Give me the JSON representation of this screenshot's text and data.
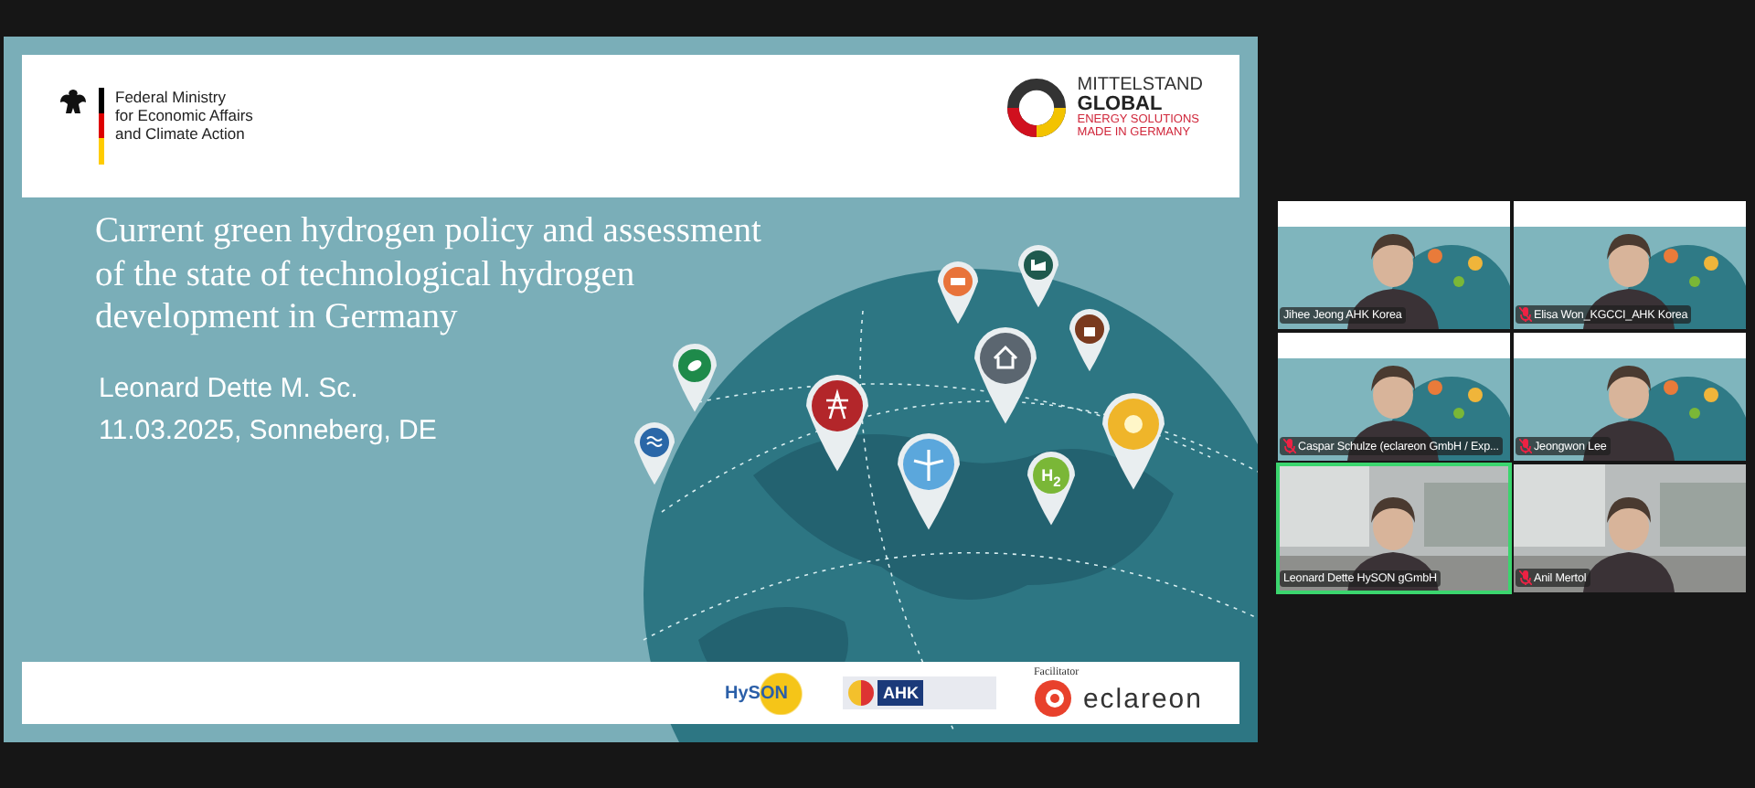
{
  "slide": {
    "header": {
      "ministry_lines": [
        "Federal Ministry",
        "for Economic Affairs",
        "and Climate Action"
      ],
      "brand_name": "MITTELSTAND",
      "brand_bold": "GLOBAL",
      "brand_tagline": [
        "ENERGY SOLUTIONS",
        "MADE IN GERMANY"
      ]
    },
    "title_lines": [
      "Current green hydrogen policy and assessment",
      "of the state of technological hydrogen",
      "development in Germany"
    ],
    "speaker": "Leonard Dette M. Sc.",
    "date_place": "11.03.2025, Sonneberg, DE",
    "pin_label": "H$_{2}$",
    "footer": {
      "hyson": "HySON",
      "ahk": "AHK",
      "facilitator": "Facilitator",
      "eclareon": "eclareon"
    }
  },
  "participants": [
    {
      "name": "Jihee Jeong AHK Korea",
      "muted": false,
      "speaking": false
    },
    {
      "name": "Elisa Won_KGCCI_AHK Korea",
      "muted": true,
      "speaking": false
    },
    {
      "name": "Caspar Schulze (eclareon GmbH / Exp...",
      "muted": true,
      "speaking": false
    },
    {
      "name": "Jeongwon Lee",
      "muted": true,
      "speaking": false
    },
    {
      "name": "Leonard Dette HySON gGmbH",
      "muted": false,
      "speaking": true
    },
    {
      "name": "Anil Mertol",
      "muted": true,
      "speaking": false
    }
  ]
}
